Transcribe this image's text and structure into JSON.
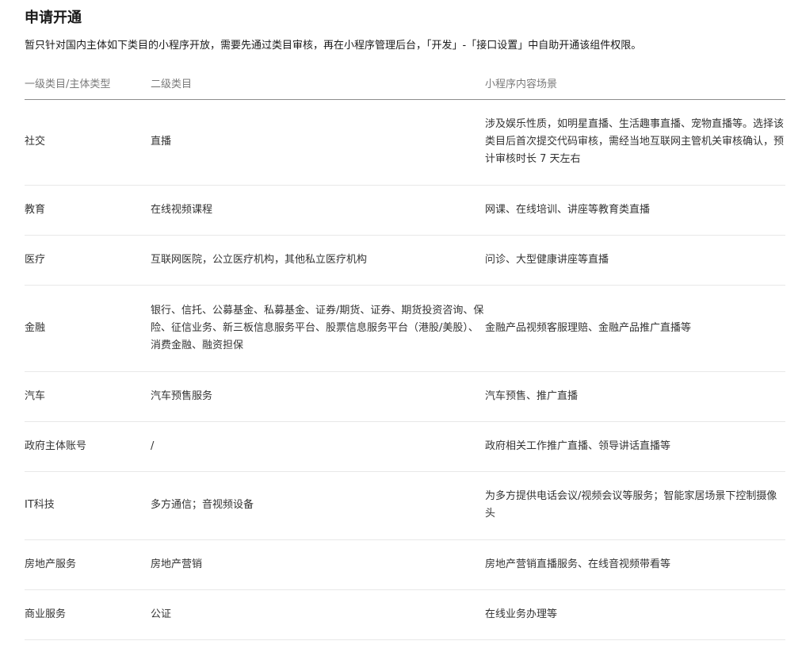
{
  "title": "申请开通",
  "description": "暂只针对国内主体如下类目的小程序开放，需要先通过类目审核，再在小程序管理后台，「开发」-「接口设置」中自助开通该组件权限。",
  "table": {
    "headers": [
      "一级类目/主体类型",
      "二级类目",
      "小程序内容场景"
    ],
    "rows": [
      {
        "category": "社交",
        "subcategory": "直播",
        "scene": "涉及娱乐性质，如明星直播、生活趣事直播、宠物直播等。选择该类目后首次提交代码审核，需经当地互联网主管机关审核确认，预计审核时长 7 天左右"
      },
      {
        "category": "教育",
        "subcategory": "在线视频课程",
        "scene": "网课、在线培训、讲座等教育类直播"
      },
      {
        "category": "医疗",
        "subcategory": "互联网医院，公立医疗机构，其他私立医疗机构",
        "scene": "问诊、大型健康讲座等直播"
      },
      {
        "category": "金融",
        "subcategory": "银行、信托、公募基金、私募基金、证券/期货、证券、期货投资咨询、保险、征信业务、新三板信息服务平台、股票信息服务平台（港股/美股）、消费金融、融资担保",
        "scene": "金融产品视频客服理赔、金融产品推广直播等"
      },
      {
        "category": "汽车",
        "subcategory": "汽车预售服务",
        "scene": "汽车预售、推广直播"
      },
      {
        "category": "政府主体账号",
        "subcategory": "/",
        "scene": "政府相关工作推广直播、领导讲话直播等"
      },
      {
        "category": "IT科技",
        "subcategory": "多方通信；音视频设备",
        "scene": "为多方提供电话会议/视频会议等服务；智能家居场景下控制摄像头"
      },
      {
        "category": "房地产服务",
        "subcategory": "房地产营销",
        "scene": "房地产营销直播服务、在线音视频带看等"
      },
      {
        "category": "商业服务",
        "subcategory": "公证",
        "scene": "在线业务办理等"
      }
    ]
  }
}
